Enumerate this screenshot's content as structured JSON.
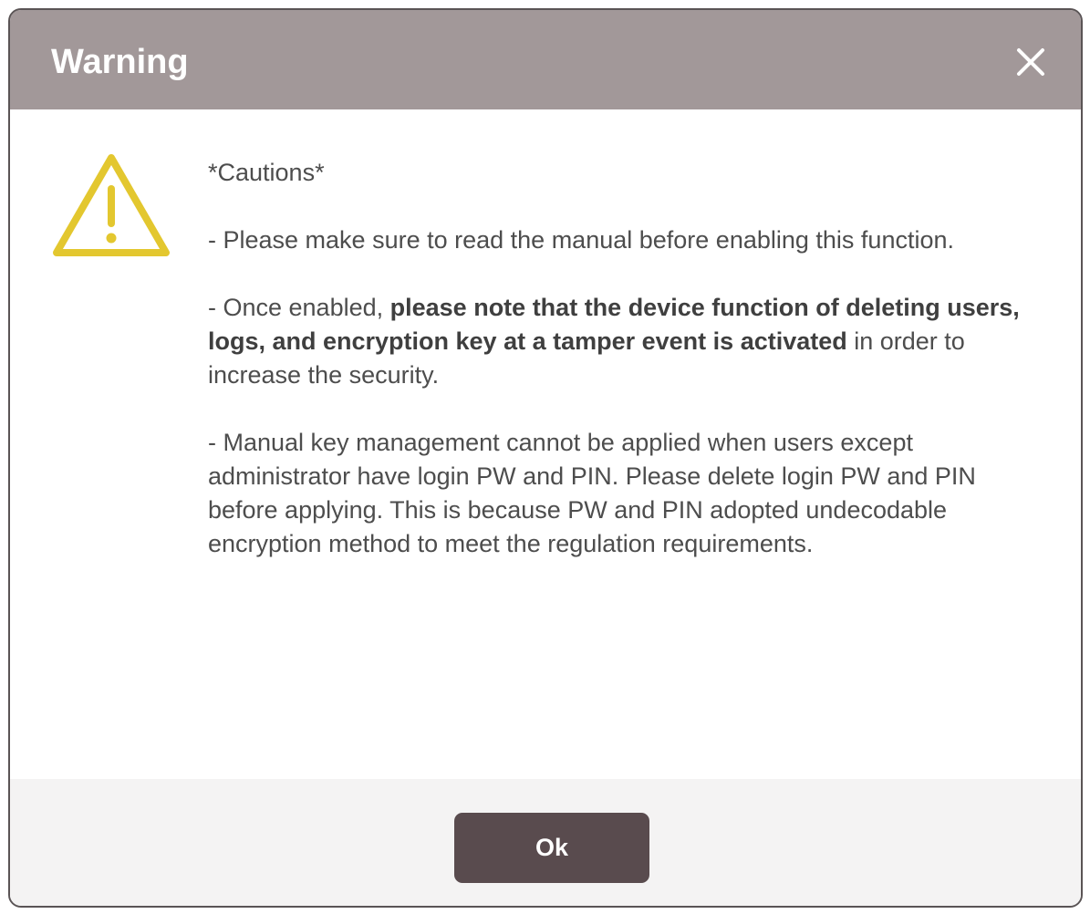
{
  "dialog": {
    "title": "Warning",
    "close_icon": "close-icon",
    "warning_icon": "warning-triangle-icon",
    "colors": {
      "titlebar": "#a29899",
      "icon": "#e3c72f",
      "button": "#594b4e",
      "footer": "#f4f3f3"
    }
  },
  "message": {
    "heading": "*Cautions*",
    "para1": "- Please make sure to read the manual before enabling this function.",
    "para2_prefix": "- Once enabled, ",
    "para2_bold": "please note that the device function of deleting users, logs, and encryption key at a tamper event is activated",
    "para2_suffix": " in order to increase the security.",
    "para3": "- Manual key management cannot be applied when users except administrator have login PW and PIN. Please delete login PW and PIN before applying. This is because PW and PIN adopted undecodable encryption method to meet the regulation requirements."
  },
  "footer": {
    "ok_label": "Ok"
  }
}
